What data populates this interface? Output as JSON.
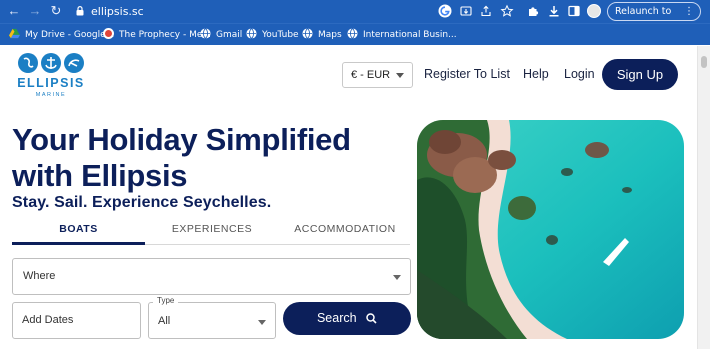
{
  "browser": {
    "url": "ellipsis.sc",
    "relaunch_label": "Relaunch to update",
    "bookmarks": [
      {
        "label": "My Drive - Google...",
        "icon": "google-drive-icon",
        "color": "#2c9a47"
      },
      {
        "label": "The Prophecy - Me...",
        "icon": "prophecy-icon",
        "color": "#e0453a"
      },
      {
        "label": "Gmail",
        "icon": "globe-icon",
        "color": "#ffffff"
      },
      {
        "label": "YouTube",
        "icon": "globe-icon",
        "color": "#ffffff"
      },
      {
        "label": "Maps",
        "icon": "globe-icon",
        "color": "#ffffff"
      },
      {
        "label": "International Busin...",
        "icon": "globe-icon",
        "color": "#ffffff"
      }
    ]
  },
  "header": {
    "logo_word": "ELLIPSIS",
    "logo_sub": "MARINE",
    "currency": "€ - EUR",
    "register_label": "Register To List",
    "help_label": "Help",
    "login_label": "Login",
    "signup_label": "Sign Up"
  },
  "hero": {
    "title": "Your Holiday Simplified with Ellipsis",
    "subtitle": "Stay. Sail. Experience Seychelles."
  },
  "tabs": [
    {
      "label": "BOATS",
      "active": true
    },
    {
      "label": "EXPERIENCES",
      "active": false
    },
    {
      "label": "ACCOMMODATION",
      "active": false
    }
  ],
  "search": {
    "where_placeholder": "Where",
    "dates_placeholder": "Add Dates",
    "type_label": "Type",
    "type_value": "All",
    "button_label": "Search"
  },
  "colors": {
    "brand_navy": "#0c1f5a",
    "brand_blue": "#1b7fc4",
    "chrome_blue": "#1f5fb8"
  }
}
